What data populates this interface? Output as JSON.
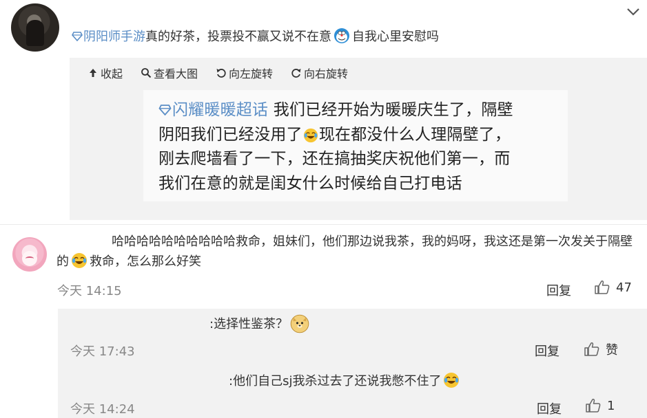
{
  "post": {
    "tag": "阴阳师手游",
    "text_before_emoji": "真的好茶，投票投不赢又说不在意",
    "text_after_emoji": "自我心里安慰吗"
  },
  "toolbar": {
    "collapse": "收起",
    "view_large": "查看大图",
    "rotate_left": "向左旋转",
    "rotate_right": "向右旋转"
  },
  "image_text": {
    "tag": "闪耀暖暖超话",
    "line1": "我们已经开始为暖暖庆生了，隔壁",
    "line2a": "阴阳我们已经没用了",
    "line2b": "现在都没什么人理隔壁了，",
    "line3": "刚去爬墙看了一下，还在搞抽奖庆祝他们第一，而",
    "line4": "我们在意的就是闺女什么时候给自己打电话"
  },
  "comment": {
    "text_a": "哈哈哈哈哈哈哈哈哈哈救命，姐妹们，他们那边说我茶，我的妈呀，我这还是第一次发关于隔壁的",
    "text_b": "救命，怎么那么好笑",
    "time": "今天 14:15",
    "reply": "回复",
    "likes": "47"
  },
  "replies": [
    {
      "text": ":选择性鉴茶？",
      "time": "今天 17:43",
      "reply": "回复",
      "likes": "赞"
    },
    {
      "text": ":他们自己sj我杀过去了还说我憋不住了",
      "time": "今天 14:24",
      "reply": "回复",
      "likes": "1"
    }
  ],
  "colors": {
    "link": "#5b8ec6",
    "panel": "#f2f2f2",
    "muted": "#888888"
  },
  "icons": [
    "chevron-down-icon",
    "super-topic-diamond-icon",
    "doraemon-emoji-icon",
    "laugh-cry-emoji-icon",
    "doge-emoji-icon",
    "thumb-up-icon"
  ]
}
